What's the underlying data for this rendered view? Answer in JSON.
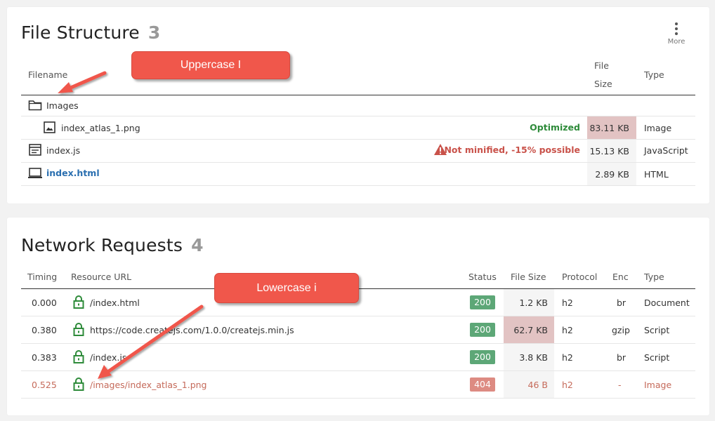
{
  "file_structure": {
    "title": "File Structure",
    "count": "3",
    "more_label": "More",
    "headers": {
      "filename": "Filename",
      "file_size_1": "File",
      "file_size_2": "Size",
      "type": "Type"
    },
    "rows": [
      {
        "name": "Images",
        "status": "",
        "size": "",
        "type": "",
        "icon": "folder-icon"
      },
      {
        "name": "index_atlas_1.png",
        "status": "Optimized",
        "size": "83.11 KB",
        "type": "Image",
        "icon": "image-icon"
      },
      {
        "name": "index.js",
        "status": "Not minified, -15% possible",
        "size": "15.13 KB",
        "type": "JavaScript",
        "icon": "script-file-icon"
      },
      {
        "name": "index.html",
        "status": "",
        "size": "2.89 KB",
        "type": "HTML",
        "icon": "laptop-icon"
      }
    ]
  },
  "network_requests": {
    "title": "Network Requests",
    "count": "4",
    "headers": {
      "timing": "Timing",
      "url": "Resource URL",
      "status": "Status",
      "file_size": "File Size",
      "protocol": "Protocol",
      "enc": "Enc",
      "type": "Type"
    },
    "rows": [
      {
        "timing": "0.000",
        "url": "/index.html",
        "status": "200",
        "size": "1.2 KB",
        "protocol": "h2",
        "enc": "br",
        "type": "Document"
      },
      {
        "timing": "0.380",
        "url": "https://code.createjs.com/1.0.0/createjs.min.js",
        "status": "200",
        "size": "62.7 KB",
        "protocol": "h2",
        "enc": "gzip",
        "type": "Script"
      },
      {
        "timing": "0.383",
        "url": "/index.js",
        "status": "200",
        "size": "3.8 KB",
        "protocol": "h2",
        "enc": "br",
        "type": "Script"
      },
      {
        "timing": "0.525",
        "url": "/images/index_atlas_1.png",
        "status": "404",
        "size": "46 B",
        "protocol": "h2",
        "enc": "-",
        "type": "Image"
      }
    ]
  },
  "annotations": {
    "uppercase_label": "Uppercase I",
    "lowercase_label": "Lowercase i"
  },
  "colors": {
    "callout": "#f0574b",
    "ok_green": "#2e8b3a",
    "error_red": "#c9524a",
    "link_blue": "#2a6fb0",
    "badge_green": "#5da777",
    "badge_red": "#dd8b82",
    "size_warn_bg": "#e2c3c3"
  }
}
